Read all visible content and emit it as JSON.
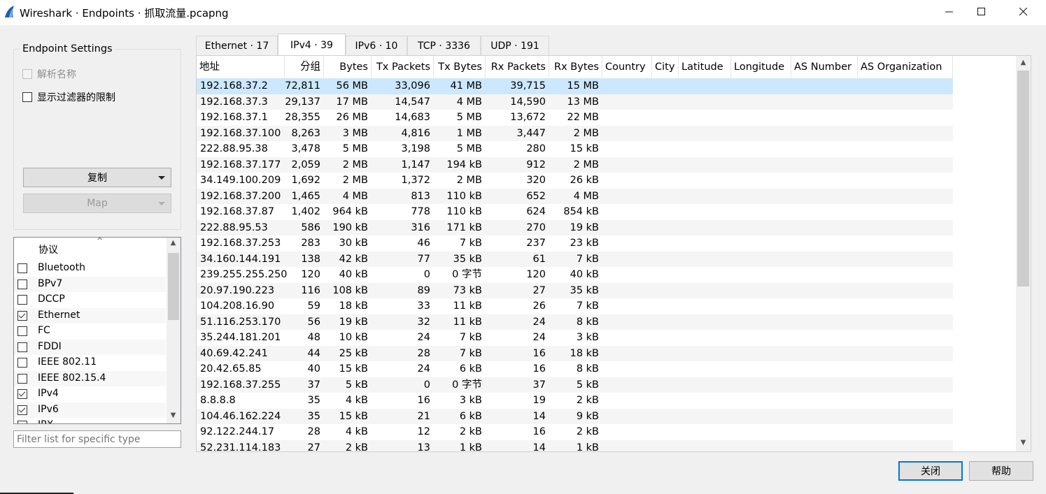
{
  "window": {
    "title": "Wireshark · Endpoints · 抓取流量.pcapng",
    "app_icon": "wireshark-fin-icon",
    "controls": [
      "minimize-icon",
      "maximize-icon",
      "close-icon"
    ]
  },
  "settings": {
    "group_title": "Endpoint Settings",
    "resolve_names_label": "解析名称",
    "resolve_names_checked": false,
    "resolve_names_enabled": false,
    "limit_filter_label": "显示过滤器的限制",
    "limit_filter_checked": false,
    "copy_button": "复制",
    "map_button": "Map"
  },
  "protocol_list": {
    "header": "协议",
    "items": [
      {
        "label": "Bluetooth",
        "checked": false
      },
      {
        "label": "BPv7",
        "checked": false
      },
      {
        "label": "DCCP",
        "checked": false
      },
      {
        "label": "Ethernet",
        "checked": true
      },
      {
        "label": "FC",
        "checked": false
      },
      {
        "label": "FDDI",
        "checked": false
      },
      {
        "label": "IEEE 802.11",
        "checked": false
      },
      {
        "label": "IEEE 802.15.4",
        "checked": false
      },
      {
        "label": "IPv4",
        "checked": true
      },
      {
        "label": "IPv6",
        "checked": true
      },
      {
        "label": "IPX",
        "checked": false
      }
    ]
  },
  "filter": {
    "placeholder": "Filter list for specific type"
  },
  "tabs": [
    {
      "label": "Ethernet · 17",
      "active": false
    },
    {
      "label": "IPv4 · 39",
      "active": true
    },
    {
      "label": "IPv6 · 10",
      "active": false
    },
    {
      "label": "TCP · 3336",
      "active": false
    },
    {
      "label": "UDP · 191",
      "active": false
    }
  ],
  "table": {
    "columns": [
      "地址",
      "分组",
      "Bytes",
      "Tx Packets",
      "Tx Bytes",
      "Rx Packets",
      "Rx Bytes",
      "Country",
      "City",
      "Latitude",
      "Longitude",
      "AS Number",
      "AS Organization"
    ],
    "selected_row": 0,
    "rows": [
      [
        "192.168.37.2",
        "72,811",
        "56 MB",
        "33,096",
        "41 MB",
        "39,715",
        "15 MB"
      ],
      [
        "192.168.37.3",
        "29,137",
        "17 MB",
        "14,547",
        "4 MB",
        "14,590",
        "13 MB"
      ],
      [
        "192.168.37.1",
        "28,355",
        "26 MB",
        "14,683",
        "5 MB",
        "13,672",
        "22 MB"
      ],
      [
        "192.168.37.100",
        "8,263",
        "3 MB",
        "4,816",
        "1 MB",
        "3,447",
        "2 MB"
      ],
      [
        "222.88.95.38",
        "3,478",
        "5 MB",
        "3,198",
        "5 MB",
        "280",
        "15 kB"
      ],
      [
        "192.168.37.177",
        "2,059",
        "2 MB",
        "1,147",
        "194 kB",
        "912",
        "2 MB"
      ],
      [
        "34.149.100.209",
        "1,692",
        "2 MB",
        "1,372",
        "2 MB",
        "320",
        "26 kB"
      ],
      [
        "192.168.37.200",
        "1,465",
        "4 MB",
        "813",
        "110 kB",
        "652",
        "4 MB"
      ],
      [
        "192.168.37.87",
        "1,402",
        "964 kB",
        "778",
        "110 kB",
        "624",
        "854 kB"
      ],
      [
        "222.88.95.53",
        "586",
        "190 kB",
        "316",
        "171 kB",
        "270",
        "19 kB"
      ],
      [
        "192.168.37.253",
        "283",
        "30 kB",
        "46",
        "7 kB",
        "237",
        "23 kB"
      ],
      [
        "34.160.144.191",
        "138",
        "42 kB",
        "77",
        "35 kB",
        "61",
        "7 kB"
      ],
      [
        "239.255.255.250",
        "120",
        "40 kB",
        "0",
        "0 字节",
        "120",
        "40 kB"
      ],
      [
        "20.97.190.223",
        "116",
        "108 kB",
        "89",
        "73 kB",
        "27",
        "35 kB"
      ],
      [
        "104.208.16.90",
        "59",
        "18 kB",
        "33",
        "11 kB",
        "26",
        "7 kB"
      ],
      [
        "51.116.253.170",
        "56",
        "19 kB",
        "32",
        "11 kB",
        "24",
        "8 kB"
      ],
      [
        "35.244.181.201",
        "48",
        "10 kB",
        "24",
        "7 kB",
        "24",
        "3 kB"
      ],
      [
        "40.69.42.241",
        "44",
        "25 kB",
        "28",
        "7 kB",
        "16",
        "18 kB"
      ],
      [
        "20.42.65.85",
        "40",
        "15 kB",
        "24",
        "6 kB",
        "16",
        "8 kB"
      ],
      [
        "192.168.37.255",
        "37",
        "5 kB",
        "0",
        "0 字节",
        "37",
        "5 kB"
      ],
      [
        "8.8.8.8",
        "35",
        "4 kB",
        "16",
        "3 kB",
        "19",
        "2 kB"
      ],
      [
        "104.46.162.224",
        "35",
        "15 kB",
        "21",
        "6 kB",
        "14",
        "9 kB"
      ],
      [
        "92.122.244.17",
        "28",
        "4 kB",
        "12",
        "2 kB",
        "16",
        "2 kB"
      ],
      [
        "52.231.114.183",
        "27",
        "2 kB",
        "13",
        "1 kB",
        "14",
        "1 kB"
      ]
    ]
  },
  "buttons": {
    "close": "关闭",
    "help": "帮助"
  },
  "colors": {
    "selection": "#cce8ff",
    "accent": "#0078d7",
    "app_icon": "#1f5fad"
  }
}
